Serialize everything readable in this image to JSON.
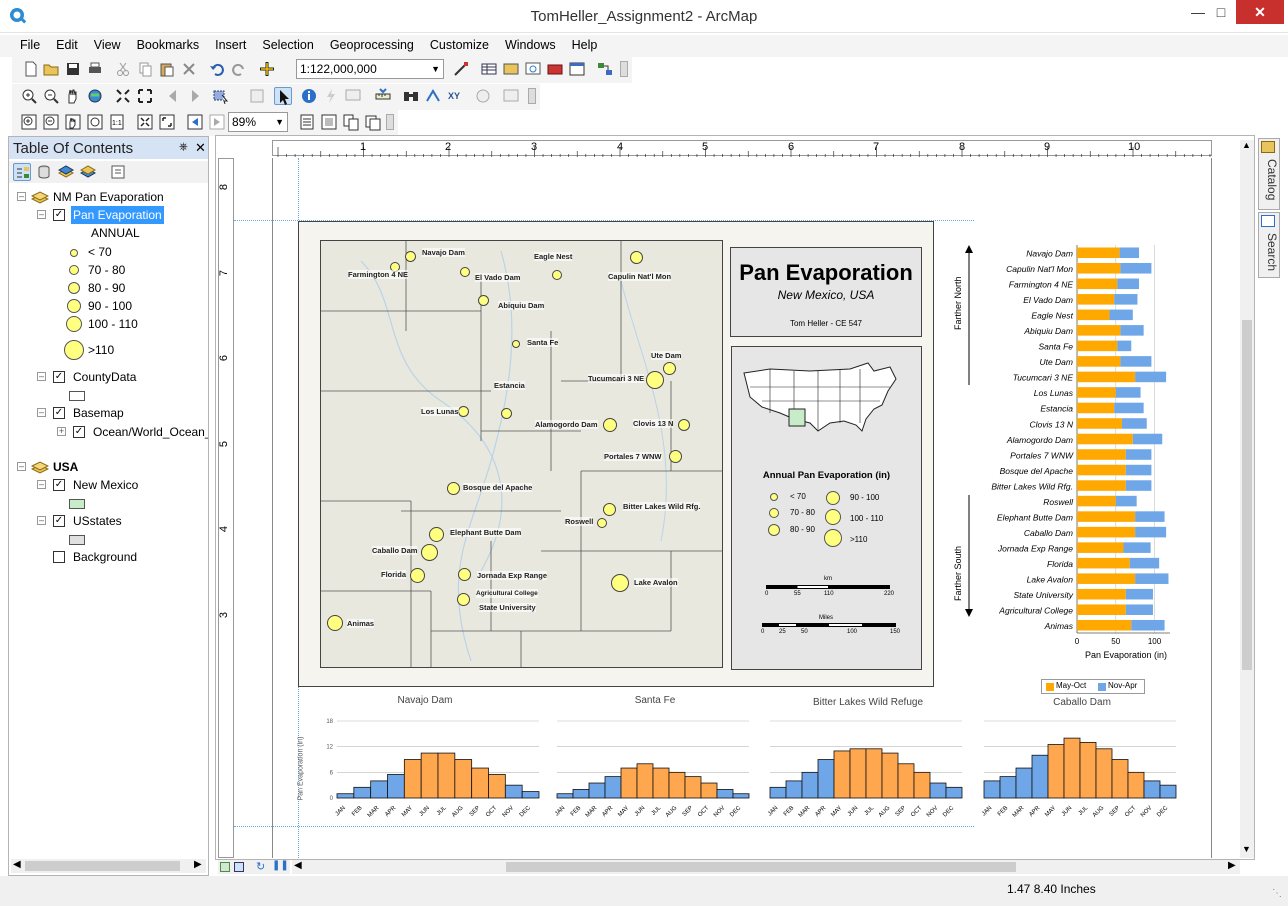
{
  "window": {
    "title": "TomHeller_Assignment2 - ArcMap"
  },
  "menu": [
    "File",
    "Edit",
    "View",
    "Bookmarks",
    "Insert",
    "Selection",
    "Geoprocessing",
    "Customize",
    "Windows",
    "Help"
  ],
  "toolbar": {
    "scale": "1:122,000,000",
    "zoom": "89%"
  },
  "toc": {
    "title": "Table Of Contents",
    "dataframes": [
      {
        "name": "NM Pan Evaporation",
        "layers": [
          {
            "name": "Pan Evaporation",
            "field": "ANNUAL",
            "classes": [
              "< 70",
              "70 - 80",
              "80 - 90",
              "90 - 100",
              "100 - 110",
              ">110"
            ]
          },
          {
            "name": "CountyData"
          },
          {
            "name": "Basemap",
            "sublayer": "Ocean/World_Ocean_"
          }
        ]
      },
      {
        "name": "USA",
        "layers": [
          {
            "name": "New Mexico"
          },
          {
            "name": "USstates"
          },
          {
            "name": "Background"
          }
        ]
      }
    ]
  },
  "rulers": {
    "top": [
      "1",
      "2",
      "3",
      "4",
      "5",
      "6",
      "7",
      "8",
      "9",
      "10"
    ],
    "left": [
      "8",
      "7",
      "6",
      "5",
      "4",
      "3"
    ]
  },
  "map": {
    "title": "Pan Evaporation",
    "subtitle": "New Mexico, USA",
    "author": "Tom Heller - CE 547",
    "legend_title": "Annual Pan Evaporation (in)",
    "legend_classes": [
      "< 70",
      "70 - 80",
      "80 - 90",
      "90 - 100",
      "100 - 110",
      ">110"
    ],
    "scalebar_km": {
      "unit": "km",
      "ticks": [
        "0",
        "55",
        "110",
        "220"
      ]
    },
    "scalebar_miles": {
      "unit": "Miles",
      "ticks": [
        "0",
        "25",
        "50",
        "100",
        "150"
      ]
    },
    "cities": [
      {
        "name": "Navajo Dam"
      },
      {
        "name": "Farmington 4 NE"
      },
      {
        "name": "El Vado Dam"
      },
      {
        "name": "Eagle Nest"
      },
      {
        "name": "Capulin Nat'l Mon"
      },
      {
        "name": "Abiquiu Dam"
      },
      {
        "name": "Santa Fe"
      },
      {
        "name": "Ute Dam"
      },
      {
        "name": "Estancia"
      },
      {
        "name": "Tucumcari 3 NE"
      },
      {
        "name": "Los Lunas"
      },
      {
        "name": "Alamogordo Dam"
      },
      {
        "name": "Clovis 13 N"
      },
      {
        "name": "Portales 7 WNW"
      },
      {
        "name": "Bosque del Apache"
      },
      {
        "name": "Bitter Lakes Wild Rfg."
      },
      {
        "name": "Roswell"
      },
      {
        "name": "Elephant Butte Dam"
      },
      {
        "name": "Caballo Dam"
      },
      {
        "name": "Florida"
      },
      {
        "name": "Jornada Exp Range"
      },
      {
        "name": "Agricultural College"
      },
      {
        "name": "State University"
      },
      {
        "name": "Lake Avalon"
      },
      {
        "name": "Animas"
      }
    ]
  },
  "chart_data": [
    {
      "type": "bar",
      "title": "",
      "xlabel": "Pan Evaporation (in)",
      "ylabel": "",
      "annotations": [
        "Farther North",
        "Farther South"
      ],
      "categories": [
        "Navajo Dam",
        "Capulin Nat'l Mon",
        "Farmington 4 NE",
        "El Vado Dam",
        "Eagle Nest",
        "Abiquiu Dam",
        "Santa Fe",
        "Ute Dam",
        "Tucumcari 3 NE",
        "Los Lunas",
        "Estancia",
        "Clovis 13 N",
        "Alamogordo Dam",
        "Portales 7 WNW",
        "Bosque del Apache",
        "Bitter Lakes Wild Rfg.",
        "Roswell",
        "Elephant Butte Dam",
        "Caballo Dam",
        "Jornada Exp Range",
        "Florida",
        "Lake Avalon",
        "State University",
        "Agricultural College",
        "Animas"
      ],
      "series": [
        {
          "name": "May-Oct",
          "values": [
            55,
            56,
            52,
            48,
            42,
            56,
            52,
            56,
            75,
            50,
            48,
            58,
            72,
            63,
            63,
            63,
            50,
            75,
            75,
            60,
            68,
            75,
            63,
            63,
            70
          ]
        },
        {
          "name": "Nov-Apr",
          "values": [
            25,
            40,
            28,
            30,
            30,
            30,
            18,
            40,
            40,
            32,
            38,
            32,
            38,
            33,
            33,
            33,
            27,
            38,
            40,
            35,
            38,
            43,
            35,
            35,
            43
          ]
        }
      ],
      "xlim": [
        0,
        120
      ],
      "xticks": [
        "0",
        "50",
        "100"
      ],
      "legend": "bottom",
      "colors": {
        "May-Oct": "#ffa800",
        "Nov-Apr": "#6ea6e8"
      }
    },
    {
      "type": "bar",
      "title": "Navajo Dam",
      "ylabel": "Pan Evaporation (in)",
      "categories": [
        "JAN",
        "FEB",
        "MAR",
        "APR",
        "MAY",
        "JUN",
        "JUL",
        "AUG",
        "SEP",
        "OCT",
        "NOV",
        "DEC"
      ],
      "values": [
        1,
        2.5,
        4,
        5.5,
        9,
        10.5,
        10.5,
        9,
        7,
        5.5,
        3,
        1.5
      ],
      "ylim": [
        0,
        18
      ],
      "yticks": [
        "0",
        "6",
        "12",
        "18"
      ]
    },
    {
      "type": "bar",
      "title": "Santa Fe",
      "categories": [
        "JAN",
        "FEB",
        "MAR",
        "APR",
        "MAY",
        "JUN",
        "JUL",
        "AUG",
        "SEP",
        "OCT",
        "NOV",
        "DEC"
      ],
      "values": [
        1,
        2,
        3.5,
        5,
        7,
        8,
        7,
        6,
        5,
        3.5,
        2,
        1
      ],
      "ylim": [
        0,
        18
      ]
    },
    {
      "type": "bar",
      "title": "Bitter Lakes Wild Refuge",
      "categories": [
        "JAN",
        "FEB",
        "MAR",
        "APR",
        "MAY",
        "JUN",
        "JUL",
        "AUG",
        "SEP",
        "OCT",
        "NOV",
        "DEC"
      ],
      "values": [
        2.5,
        4,
        6,
        9,
        11,
        11.5,
        11.5,
        10.5,
        8,
        6,
        3.5,
        2.5
      ],
      "ylim": [
        0,
        18
      ]
    },
    {
      "type": "bar",
      "title": "Caballo Dam",
      "categories": [
        "JAN",
        "FEB",
        "MAR",
        "APR",
        "MAY",
        "JUN",
        "JUL",
        "AUG",
        "SEP",
        "OCT",
        "NOV",
        "DEC"
      ],
      "values": [
        4,
        5,
        7,
        10,
        12.5,
        14,
        13,
        11.5,
        9,
        6,
        4,
        3
      ],
      "ylim": [
        0,
        18
      ]
    }
  ],
  "status": {
    "coords": "1.47  8.40 Inches"
  },
  "side_tabs": [
    "Catalog",
    "Search"
  ]
}
